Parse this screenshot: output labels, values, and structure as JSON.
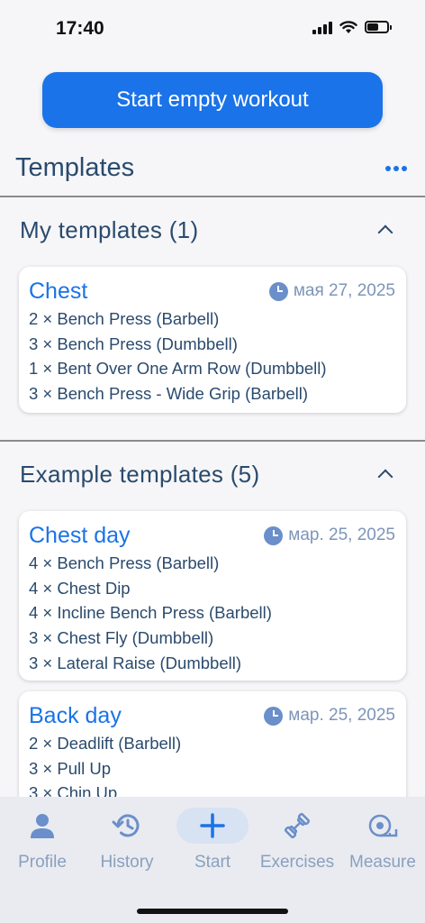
{
  "status_bar": {
    "time": "17:40"
  },
  "start_button": {
    "label": "Start empty workout"
  },
  "templates_title": "Templates",
  "my_templates": {
    "header": "My templates (1)",
    "cards": [
      {
        "title": "Chest",
        "date": "мая 27, 2025",
        "exercises": [
          "2 × Bench Press (Barbell)",
          "3 × Bench Press (Dumbbell)",
          "1 × Bent Over One Arm Row (Dumbbell)",
          "3 × Bench Press - Wide Grip (Barbell)"
        ]
      }
    ]
  },
  "example_templates": {
    "header": "Example templates (5)",
    "cards": [
      {
        "title": "Chest day",
        "date": "мар. 25, 2025",
        "exercises": [
          "4 × Bench Press (Barbell)",
          "4 × Chest Dip",
          "4 × Incline Bench Press (Barbell)",
          "3 × Chest Fly (Dumbbell)",
          "3 × Lateral Raise (Dumbbell)"
        ]
      },
      {
        "title": "Back day",
        "date": "мар. 25, 2025",
        "exercises": [
          "2 × Deadlift (Barbell)",
          "3 × Pull Up",
          "3 × Chin Up"
        ]
      }
    ]
  },
  "nav": {
    "items": [
      {
        "label": "Profile",
        "icon": "person-icon"
      },
      {
        "label": "History",
        "icon": "history-icon"
      },
      {
        "label": "Start",
        "icon": "plus-icon",
        "active": true
      },
      {
        "label": "Exercises",
        "icon": "dumbbell-icon"
      },
      {
        "label": "Measure",
        "icon": "tape-measure-icon"
      }
    ]
  },
  "colors": {
    "accent": "#1a73e8",
    "text": "#2a4a6d",
    "muted": "#8aa0bf",
    "background": "#f6f6f8"
  }
}
